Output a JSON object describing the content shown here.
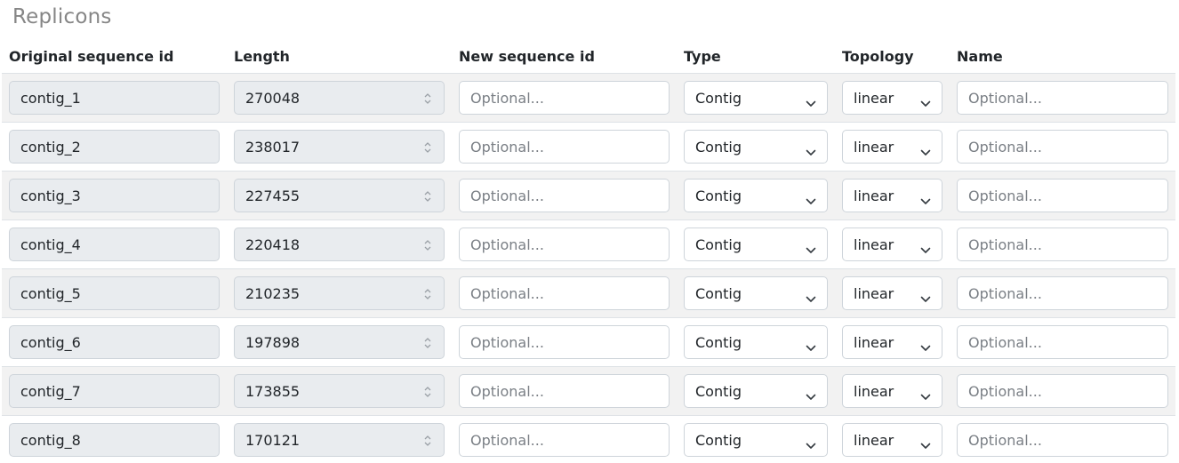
{
  "section": {
    "title": "Replicons"
  },
  "columns": {
    "original_id": "Original sequence id",
    "length": "Length",
    "new_id": "New sequence id",
    "type": "Type",
    "topology": "Topology",
    "name": "Name"
  },
  "placeholders": {
    "new_id": "Optional...",
    "name": "Optional..."
  },
  "rows": [
    {
      "original_id": "contig_1",
      "length": "270048",
      "type": "Contig",
      "topology": "linear"
    },
    {
      "original_id": "contig_2",
      "length": "238017",
      "type": "Contig",
      "topology": "linear"
    },
    {
      "original_id": "contig_3",
      "length": "227455",
      "type": "Contig",
      "topology": "linear"
    },
    {
      "original_id": "contig_4",
      "length": "220418",
      "type": "Contig",
      "topology": "linear"
    },
    {
      "original_id": "contig_5",
      "length": "210235",
      "type": "Contig",
      "topology": "linear"
    },
    {
      "original_id": "contig_6",
      "length": "197898",
      "type": "Contig",
      "topology": "linear"
    },
    {
      "original_id": "contig_7",
      "length": "173855",
      "type": "Contig",
      "topology": "linear"
    },
    {
      "original_id": "contig_8",
      "length": "170121",
      "type": "Contig",
      "topology": "linear"
    }
  ],
  "icons": {
    "spinner": "number-spinner-icon",
    "dropdown": "chevron-down-icon"
  },
  "colors": {
    "readonly_bg": "#e9ecef",
    "stripe_bg": "#f2f2f2",
    "border": "#ced4da",
    "title": "#868686"
  }
}
